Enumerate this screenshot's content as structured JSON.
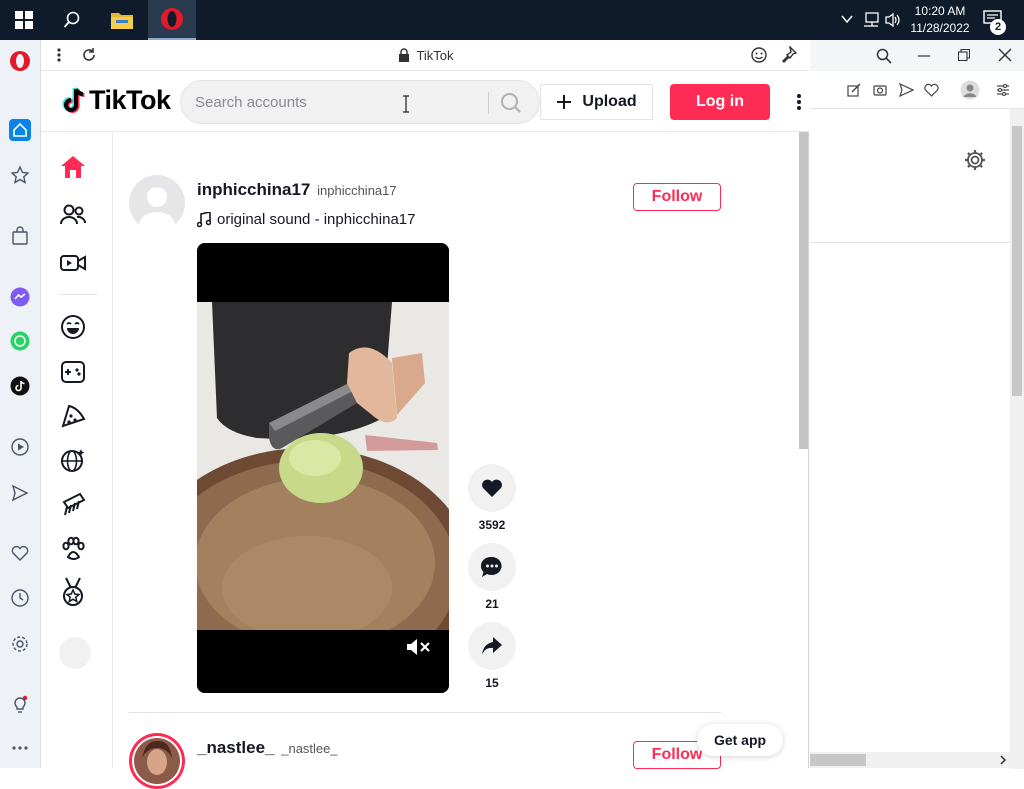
{
  "taskbar": {
    "time": "10:20 AM",
    "date": "11/28/2022",
    "notification_count": "2",
    "icons": [
      "windows-start-icon",
      "search-icon",
      "file-explorer-icon",
      "opera-icon"
    ]
  },
  "opera_sidebar": {
    "items": [
      "opera-logo-icon",
      "home-icon",
      "bookmarks-star-icon",
      "shopping-bag-icon",
      "messenger-icon",
      "whatsapp-icon",
      "tiktok-icon",
      "player-icon",
      "send-icon",
      "heart-icon",
      "history-icon",
      "settings-icon",
      "lightbulb-icon",
      "more-icon"
    ]
  },
  "popup": {
    "title": "TikTok"
  },
  "header": {
    "logo_text": "TikTok",
    "search_placeholder": "Search accounts",
    "upload_label": "Upload",
    "login_label": "Log in"
  },
  "nav": {
    "items": [
      "home-icon",
      "following-icon",
      "live-icon",
      "comedy-icon",
      "gaming-icon",
      "food-icon",
      "dance-icon",
      "beauty-icon",
      "animals-icon",
      "sports-icon"
    ]
  },
  "feed": {
    "posts": [
      {
        "username": "inphicchina17",
        "handle": "inphicchina17",
        "sound": "original sound - inphicchina17",
        "follow_label": "Follow",
        "likes": "3592",
        "comments": "21",
        "shares": "15"
      },
      {
        "username": "_nastlee_",
        "handle": "_nastlee_",
        "follow_label": "Follow"
      }
    ],
    "get_app_label": "Get app"
  },
  "colors": {
    "brand": "#fe2c55",
    "taskbar": "#0f1b2a",
    "opera_red": "#e2182b"
  }
}
